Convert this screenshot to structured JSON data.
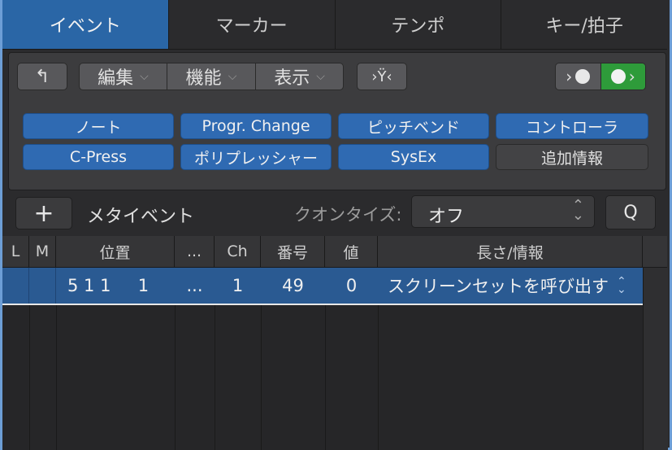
{
  "tabs": [
    {
      "label": "イベント",
      "active": true
    },
    {
      "label": "マーカー",
      "active": false
    },
    {
      "label": "テンポ",
      "active": false
    },
    {
      "label": "キー/拍子",
      "active": false
    }
  ],
  "toolbar": {
    "back_icon": "↰",
    "edit_label": "編集",
    "function_label": "機能",
    "view_label": "表示",
    "chevron": "⌵",
    "filter_icon": "›Ϋ‹"
  },
  "midi": {
    "out_icon_left": "›",
    "out_icon_right": "›",
    "palette_glyph": "🎨"
  },
  "filters": [
    {
      "label": "ノート",
      "on": true
    },
    {
      "label": "Progr. Change",
      "on": true
    },
    {
      "label": "ピッチベンド",
      "on": true
    },
    {
      "label": "コントローラ",
      "on": true
    },
    {
      "label": "C-Press",
      "on": true
    },
    {
      "label": "ポリプレッシャー",
      "on": true
    },
    {
      "label": "SysEx",
      "on": true
    },
    {
      "label": "追加情報",
      "on": false
    }
  ],
  "meta": {
    "plus_label": "+",
    "event_type": "メタイベント",
    "quantize_label": "クオンタイズ:",
    "quantize_value": "オフ",
    "q_button": "Q"
  },
  "table": {
    "headers": [
      "L",
      "M",
      "位置",
      "...",
      "Ch",
      "番号",
      "値",
      "長さ/情報"
    ],
    "rows": [
      {
        "l": "",
        "m": "",
        "position": "5 1 1     1",
        "dots": "...",
        "ch": "1",
        "num": "49",
        "val": "0",
        "info": "スクリーンセットを呼び出す"
      }
    ]
  },
  "colors": {
    "accent": "#2a66a6",
    "filter_on": "#2f6ab2",
    "midi_green": "#2e9b3a",
    "selection": "#2a5a92"
  }
}
